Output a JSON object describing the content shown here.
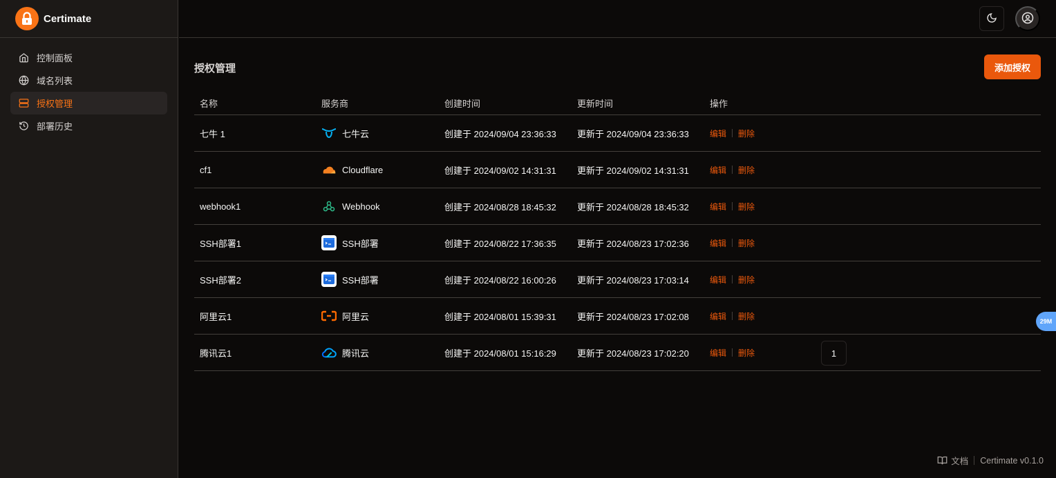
{
  "app": {
    "name": "Certimate",
    "version": "Certimate v0.1.0"
  },
  "sidebar": {
    "items": [
      {
        "label": "控制面板",
        "icon": "home-icon",
        "active": false
      },
      {
        "label": "域名列表",
        "icon": "globe-icon",
        "active": false
      },
      {
        "label": "授权管理",
        "icon": "server-icon",
        "active": true
      },
      {
        "label": "部署历史",
        "icon": "history-icon",
        "active": false
      }
    ]
  },
  "page": {
    "title": "授权管理",
    "add_label": "添加授权"
  },
  "table": {
    "headers": [
      "名称",
      "服务商",
      "创建时间",
      "更新时间",
      "操作"
    ],
    "rows": [
      {
        "name": "七牛 1",
        "provider": "七牛云",
        "provider_icon": "qiniu-icon",
        "created": "创建于 2024/09/04 23:36:33",
        "updated": "更新于 2024/09/04 23:36:33"
      },
      {
        "name": "cf1",
        "provider": "Cloudflare",
        "provider_icon": "cloudflare-icon",
        "created": "创建于 2024/09/02 14:31:31",
        "updated": "更新于 2024/09/02 14:31:31"
      },
      {
        "name": "webhook1",
        "provider": "Webhook",
        "provider_icon": "webhook-icon",
        "created": "创建于 2024/08/28 18:45:32",
        "updated": "更新于 2024/08/28 18:45:32"
      },
      {
        "name": "SSH部署1",
        "provider": "SSH部署",
        "provider_icon": "ssh-icon",
        "created": "创建于 2024/08/22 17:36:35",
        "updated": "更新于 2024/08/23 17:02:36"
      },
      {
        "name": "SSH部署2",
        "provider": "SSH部署",
        "provider_icon": "ssh-icon",
        "created": "创建于 2024/08/22 16:00:26",
        "updated": "更新于 2024/08/23 17:03:14"
      },
      {
        "name": "阿里云1",
        "provider": "阿里云",
        "provider_icon": "aliyun-icon",
        "created": "创建于 2024/08/01 15:39:31",
        "updated": "更新于 2024/08/23 17:02:08"
      },
      {
        "name": "腾讯云1",
        "provider": "腾讯云",
        "provider_icon": "tencent-cloud-icon",
        "created": "创建于 2024/08/01 15:16:29",
        "updated": "更新于 2024/08/23 17:02:20"
      }
    ],
    "edit_label": "编辑",
    "delete_label": "删除"
  },
  "pagination": {
    "current": "1"
  },
  "float_badge": "29M",
  "footer": {
    "docs_label": "文档"
  },
  "colors": {
    "accent": "#ea580c",
    "background": "#0c0a09",
    "sidebar": "#1c1917",
    "badge": "#60a5fa"
  }
}
